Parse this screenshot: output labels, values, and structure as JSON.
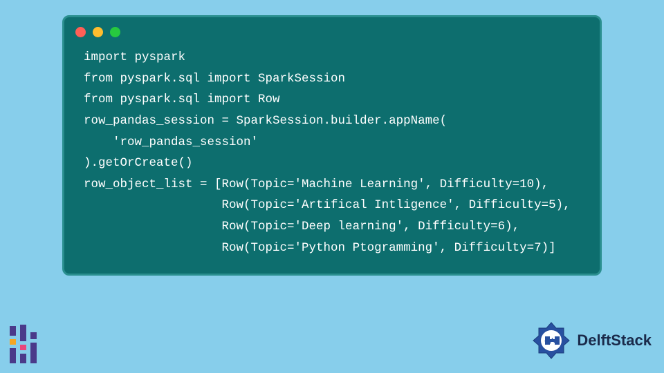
{
  "code": {
    "line1": "import pyspark",
    "line2": "from pyspark.sql import SparkSession",
    "line3": "from pyspark.sql import Row",
    "line4": "row_pandas_session = SparkSession.builder.appName(",
    "line5": "    'row_pandas_session'",
    "line6": ").getOrCreate()",
    "line7": "row_object_list = [Row(Topic='Machine Learning', Difficulty=10),",
    "line8": "                   Row(Topic='Artifical Intligence', Difficulty=5),",
    "line9": "                   Row(Topic='Deep learning', Difficulty=6),",
    "line10": "                   Row(Topic='Python Ptogramming', Difficulty=7)]"
  },
  "brand": {
    "name": "DelftStack"
  }
}
